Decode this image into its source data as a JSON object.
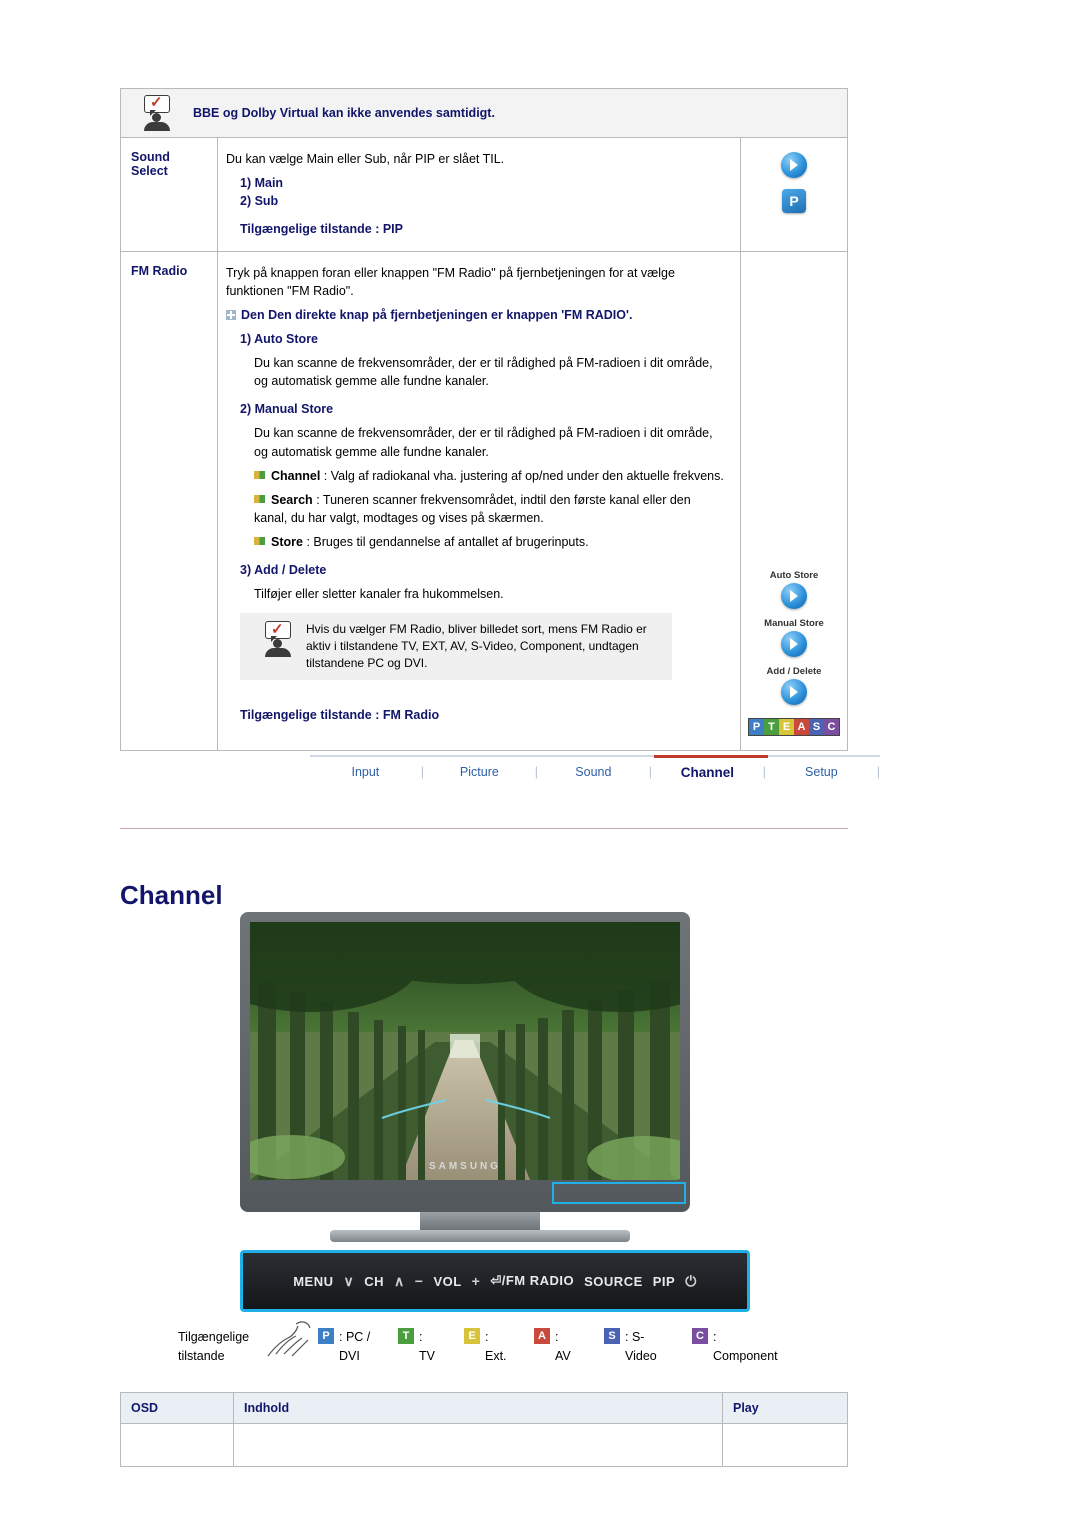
{
  "note_top": {
    "icon": "note-person-icon",
    "text": "BBE og Dolby Virtual kan ikke anvendes samtidigt."
  },
  "rows": [
    {
      "label": "Sound Select",
      "label_line1": "Sound",
      "label_line2": "Select",
      "intro": "Du kan vælge Main eller Sub, når PIP er slået TIL.",
      "items": [
        "1) Main",
        "2) Sub"
      ],
      "modes_line": "Tilgængelige tilstande : PIP",
      "icons": [
        {
          "type": "round-play-icon",
          "caption": ""
        },
        {
          "type": "square-p-icon",
          "label": "P",
          "caption": ""
        }
      ]
    },
    {
      "label": "FM Radio",
      "intro1": "Tryk på knappen foran eller knappen \"FM Radio\" på fjernbetjeningen for at vælge funktionen \"FM Radio\".",
      "direct_key": "Den Den direkte knap på fjernbetjeningen er knappen 'FM RADIO'.",
      "item1_title": "1) Auto Store",
      "item1_body": "Du kan scanne de frekvensområder, der er til rådighed på FM-radioen i dit område, og automatisk gemme alle fundne kanaler.",
      "item2_title": "2) Manual Store",
      "item2_body": "Du kan scanne de frekvensområder, der er til rådighed på FM-radioen i dit område, og automatisk gemme alle fundne kanaler.",
      "sub_channel_bold": "Channel",
      "sub_channel_text": ": Valg af radiokanal vha. justering af op/ned under den aktuelle frekvens.",
      "sub_search_bold": "Search",
      "sub_search_text": ": Tuneren scanner frekvensområdet, indtil den første kanal eller den kanal, du har valgt, modtages og vises på skærmen.",
      "sub_store_bold": "Store",
      "sub_store_text": ": Bruges til gendannelse af antallet af brugerinputs.",
      "item3_title": "3) Add / Delete",
      "item3_body": "Tilføjer eller sletter kanaler fra hukommelsen.",
      "inner_note": "Hvis du vælger FM Radio, bliver billedet sort, mens FM Radio er aktiv i tilstandene TV, EXT, AV, S-Video, Component, undtagen tilstandene PC og DVI.",
      "modes_line": "Tilgængelige tilstande : FM Radio",
      "icons": [
        {
          "caption": "Auto Store",
          "type": "round-play-icon"
        },
        {
          "caption": "Manual Store",
          "type": "round-play-icon"
        },
        {
          "caption": "Add / Delete",
          "type": "round-play-icon"
        }
      ],
      "mode_strip": [
        "P",
        "T",
        "E",
        "A",
        "S",
        "C"
      ]
    }
  ],
  "nav": {
    "items": [
      {
        "label": "Input",
        "active": false
      },
      {
        "label": "Picture",
        "active": false
      },
      {
        "label": "Sound",
        "active": false
      },
      {
        "label": "Channel",
        "active": true
      },
      {
        "label": "Setup",
        "active": false
      }
    ],
    "separator": "|",
    "active_color": "#c0392b"
  },
  "section": {
    "title": "Channel",
    "tv_brand": "SAMSUNG",
    "panel_buttons": [
      {
        "label": "MENU"
      },
      {
        "label": "∨"
      },
      {
        "label": "CH"
      },
      {
        "label": "∧"
      },
      {
        "label": "−"
      },
      {
        "label": "VOL"
      },
      {
        "label": "+"
      },
      {
        "label": "⏎/FM RADIO"
      },
      {
        "label": "SOURCE"
      },
      {
        "label": "PIP"
      },
      {
        "label": "⏻"
      }
    ]
  },
  "legend": {
    "label_line1": "Tilgængelige",
    "label_line2": "tilstande",
    "entries": [
      {
        "key": "P",
        "color": "#3c7fc4",
        "text_line1": ": PC /",
        "text_line2": "DVI"
      },
      {
        "key": "T",
        "color": "#4a9e3d",
        "text_line1": ":",
        "text_line2": "TV"
      },
      {
        "key": "E",
        "color": "#d8c43a",
        "text_line1": ":",
        "text_line2": "Ext."
      },
      {
        "key": "A",
        "color": "#c94a3a",
        "text_line1": ":",
        "text_line2": "AV"
      },
      {
        "key": "S",
        "color": "#4a63b5",
        "text_line1": ": S-",
        "text_line2": "Video"
      },
      {
        "key": "C",
        "color": "#7a4fa0",
        "text_line1": ":",
        "text_line2": "Component"
      }
    ]
  },
  "osd_table": {
    "headers": [
      "OSD",
      "Indhold",
      "Play"
    ],
    "rows": [
      [
        "",
        "",
        ""
      ]
    ]
  }
}
